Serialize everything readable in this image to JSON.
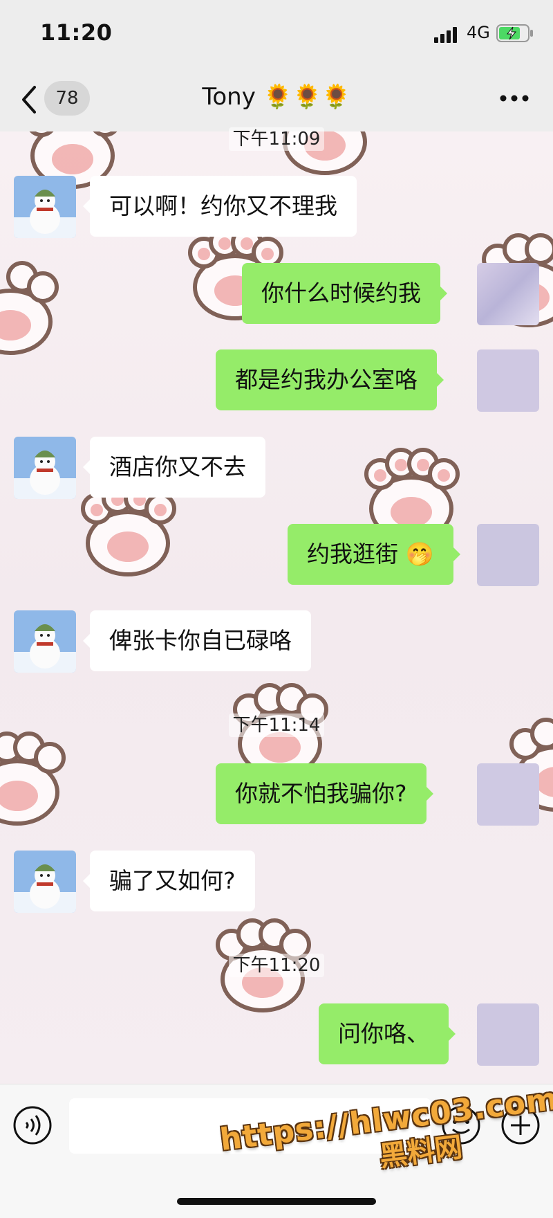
{
  "status_bar": {
    "time": "11:20",
    "network": "4G"
  },
  "nav": {
    "unread_count": "78",
    "title": "Tony 🌻🌻🌻"
  },
  "messages": [
    {
      "type": "timestamp",
      "text": "下午11:09"
    },
    {
      "type": "incoming",
      "text": "可以啊！约你又不理我"
    },
    {
      "type": "outgoing",
      "text": "你什么时候约我"
    },
    {
      "type": "outgoing",
      "text": "都是约我办公室咯"
    },
    {
      "type": "incoming",
      "text": "酒店你又不去"
    },
    {
      "type": "outgoing",
      "text": "约我逛街 🤭"
    },
    {
      "type": "incoming",
      "text": "俾张卡你自已碌咯"
    },
    {
      "type": "timestamp",
      "text": "下午11:14"
    },
    {
      "type": "outgoing",
      "text": "你就不怕我骗你?"
    },
    {
      "type": "incoming",
      "text": "骗了又如何?"
    },
    {
      "type": "timestamp",
      "text": "下午11:20"
    },
    {
      "type": "outgoing",
      "text": "问你咯、"
    }
  ],
  "watermark": {
    "url": "https://hlwc03.com",
    "site": "黑料网"
  },
  "colors": {
    "outgoing_bubble": "#95ec69",
    "incoming_bubble": "#ffffff",
    "bar": "#ededed"
  },
  "icons": [
    "back-icon",
    "more-icon",
    "voice-icon",
    "emoji-icon",
    "plus-icon",
    "signal-icon",
    "battery-icon"
  ]
}
